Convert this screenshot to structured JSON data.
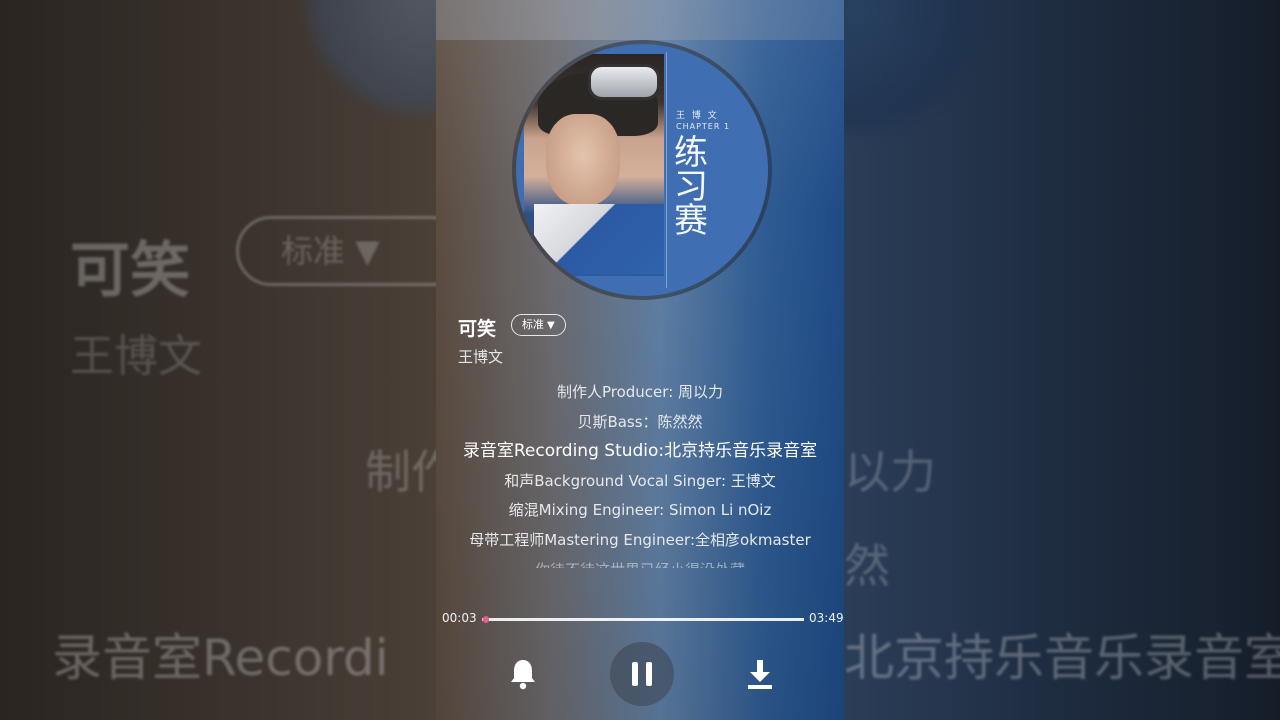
{
  "song": {
    "title": "可笑",
    "quality": "标准",
    "quality_arrow": "▼",
    "artist": "王博文"
  },
  "cover": {
    "artist_text": "王 博 文",
    "chapter_text": "CHAPTER 1",
    "album_title": "练习赛"
  },
  "lyrics": [
    "制作人Producer: 周以力",
    "贝斯Bass：陈然然",
    "录音室Recording Studio:北京持乐音乐录音室",
    "和声Background Vocal Singer: 王博文",
    "缩混Mixing Engineer: Simon Li nOiz",
    "母带工程师Mastering Engineer:全相彦okmaster",
    "你待不待这世界已经小得没处藏"
  ],
  "background": {
    "left_title": "可笑",
    "left_badge": "标准 ▼",
    "left_artist": "王博文",
    "left_line1": "制作",
    "left_line3": "录音室Recordi",
    "right_line1": "以力",
    "right_line2": "然",
    "right_line3": "北京持乐音乐录音室"
  },
  "player": {
    "current_time": "00:03",
    "total_time": "03:49",
    "progress": 0.013
  },
  "icons": {
    "bell": "bell-icon",
    "pause": "pause-icon",
    "download": "download-icon"
  },
  "colors": {
    "progress_knob": "#e06292",
    "text": "#ffffff"
  }
}
